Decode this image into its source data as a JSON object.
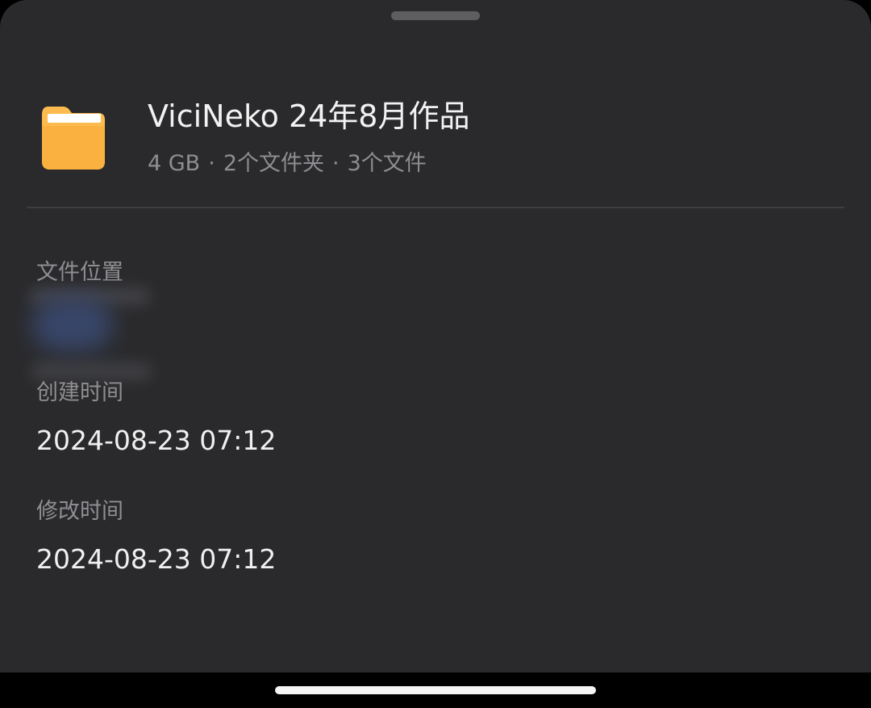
{
  "folder": {
    "title": "ViciNeko 24年8月作品",
    "size": "4 GB",
    "subfolders": "2个文件夹",
    "files": "3个文件",
    "separator": "·",
    "icon": "folder-icon",
    "icon_color": "#fdbb4f"
  },
  "details": {
    "location_label": "文件位置",
    "created_label": "创建时间",
    "created_value": "2024-08-23 07:12",
    "modified_label": "修改时间",
    "modified_value": "2024-08-23 07:12"
  },
  "colors": {
    "sheet_bg": "#2a2a2c",
    "primary_text": "#f2f2f2",
    "secondary_text": "#8e8e92"
  }
}
